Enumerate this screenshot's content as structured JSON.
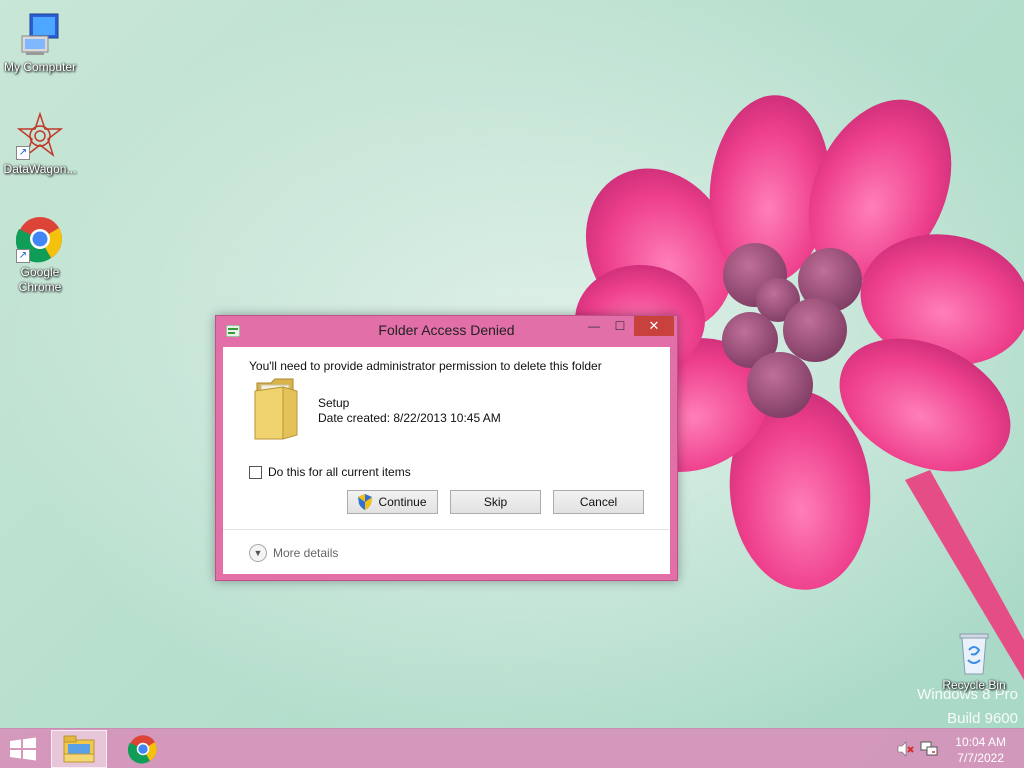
{
  "desktop": {
    "icons": [
      {
        "label": "My Computer"
      },
      {
        "label": "DataWagon..."
      },
      {
        "label": "Google Chrome"
      },
      {
        "label": "Recycle Bin"
      }
    ],
    "watermark_line1": "Windows 8 Pro",
    "watermark_line2": "Build 9600"
  },
  "dialog": {
    "title": "Folder Access Denied",
    "message": "You'll need to provide administrator permission to delete this folder",
    "folder_name": "Setup",
    "date_created": "Date created: 8/22/2013 10:45 AM",
    "checkbox_label": "Do this for all current items",
    "checkbox_checked": false,
    "continue_label": "Continue",
    "skip_label": "Skip",
    "cancel_label": "Cancel",
    "more_details_label": "More details",
    "minimize_glyph": "—",
    "maximize_glyph": "☐",
    "close_glyph": "✕"
  },
  "taskbar": {
    "apps": [
      {
        "name": "file-explorer",
        "active": true
      },
      {
        "name": "google-chrome",
        "active": false
      }
    ],
    "time": "10:04 AM",
    "date": "7/7/2022"
  },
  "colors": {
    "accent": "#e36fa8",
    "close_button": "#c9413d",
    "taskbar": "#d98cb9"
  }
}
